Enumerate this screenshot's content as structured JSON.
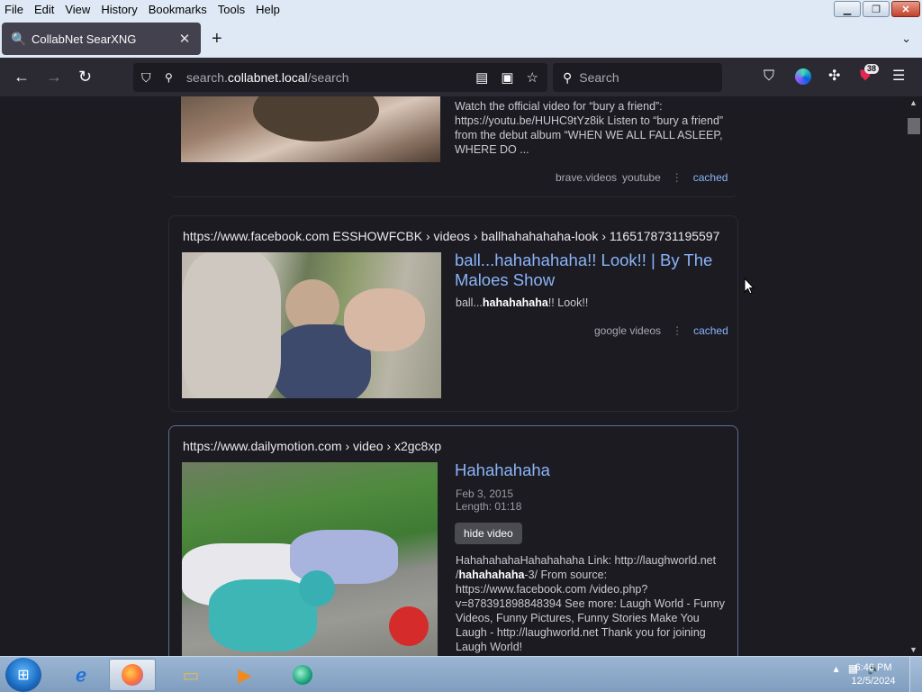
{
  "menubar": {
    "items": [
      "File",
      "Edit",
      "View",
      "History",
      "Bookmarks",
      "Tools",
      "Help"
    ]
  },
  "tab": {
    "title": "CollabNet SearXNG"
  },
  "navbar": {
    "url_prefix": "search.",
    "url_domain": "collabnet.local",
    "url_path": "/search",
    "search_placeholder": "Search",
    "extensions_badge": "38"
  },
  "results": [
    {
      "snippet": "Watch the official video for “bury a friend”: https://youtu.be/HUHC9tYz8ik Listen to “bury a friend” from the debut album “WHEN WE ALL FALL ASLEEP, WHERE DO ...",
      "engines": [
        "brave.videos",
        "youtube"
      ],
      "cached_label": "cached"
    },
    {
      "url": "https://www.facebook.com  ESSHOWFCBK › videos › ballhahahahaha-look › 1165178731195597",
      "title": "ball...hahahahaha!! Look!! | By The Maloes Show",
      "snippet_pre": "ball...",
      "snippet_bold": "hahahahaha",
      "snippet_post": "!! Look!!",
      "engines": [
        "google videos"
      ],
      "cached_label": "cached"
    },
    {
      "url": "https://www.dailymotion.com  › video › x2gc8xp",
      "title": "Hahahahaha",
      "date": "Feb 3, 2015",
      "length": "Length: 01:18",
      "hide_label": "hide video",
      "snippet_a": "HahahahahaHahahahaha Link: http://laughworld.net /",
      "snippet_bold": "hahahahaha",
      "snippet_b": "-3/ From source: https://www.facebook.com /video.php?v=878391898848394 See more: Laugh World - Funny Videos, Funny Pictures, Funny Stories Make You Laugh - http://laughworld.net Thank you for joining Laugh World!"
    }
  ],
  "taskbar": {
    "time": "6:46 PM",
    "date": "12/5/2024"
  }
}
